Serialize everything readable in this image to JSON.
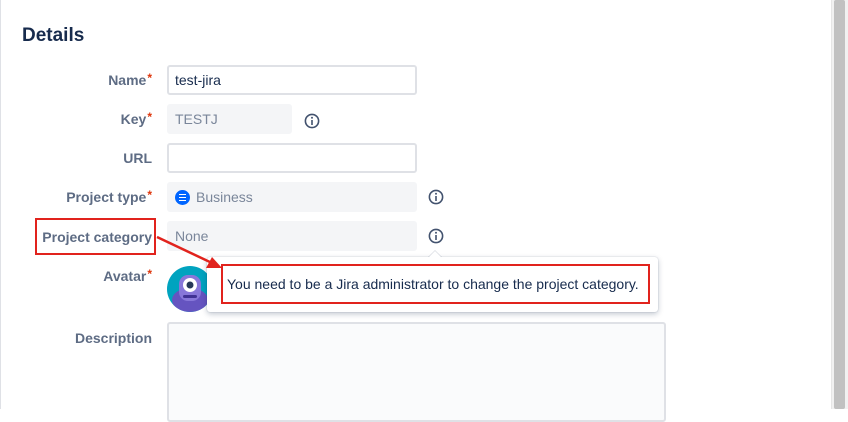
{
  "section": {
    "title": "Details"
  },
  "required_marker": "*",
  "fields": {
    "name": {
      "label": "Name",
      "value": "test-jira"
    },
    "key": {
      "label": "Key",
      "value": "TESTJ"
    },
    "url": {
      "label": "URL",
      "value": ""
    },
    "project_type": {
      "label": "Project type",
      "value": "Business"
    },
    "project_category": {
      "label": "Project category",
      "value": "None"
    },
    "avatar": {
      "label": "Avatar"
    },
    "description": {
      "label": "Description",
      "value": ""
    }
  },
  "tooltip": {
    "message": "You need to be a Jira administrator to change the project category."
  },
  "colors": {
    "required": "#de350b",
    "annotation": "#e1231d",
    "business_icon": "#0065ff",
    "avatar_bg": "#00a3bf"
  },
  "icons": [
    "info-icon",
    "business-icon"
  ]
}
